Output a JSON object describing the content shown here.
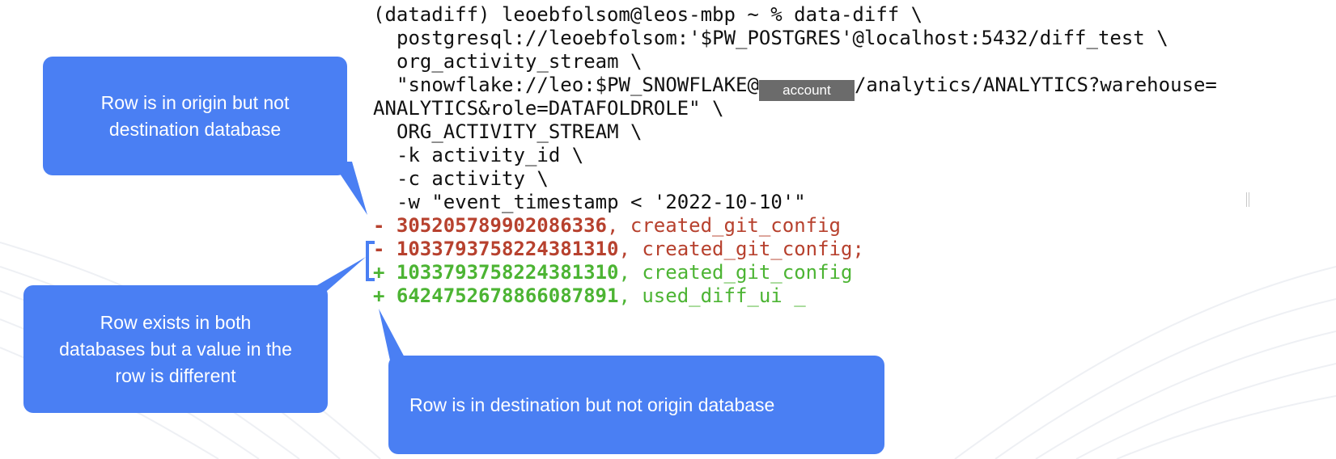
{
  "terminal": {
    "lines": {
      "l1": "(datadiff) leoebfolsom@leos-mbp ~ % data-diff \\",
      "l2": "postgresql://leoebfolsom:'$PW_POSTGRES'@localhost:5432/diff_test \\",
      "l3": "org_activity_stream \\",
      "l4_before": "\"snowflake://leo:$PW_SNOWFLAKE@",
      "l4_mask": "account",
      "l4_after": "/analytics/ANALYTICS?warehouse=",
      "l5": "ANALYTICS&role=DATAFOLDROLE\" \\",
      "l6": "ORG_ACTIVITY_STREAM \\",
      "l7": "-k activity_id \\",
      "l8": "-c activity \\",
      "l9": "-w \"event_timestamp < '2022-10-10'\""
    },
    "diff_rows": [
      {
        "sign": "-",
        "id": "305205789902086336",
        "sep": ", ",
        "value": "created_git_config"
      },
      {
        "sign": "-",
        "id": "1033793758224381310",
        "sep": ", ",
        "value": "created_git_config;"
      },
      {
        "sign": "+",
        "id": "1033793758224381310",
        "sep": ", ",
        "value": "created_git_config"
      },
      {
        "sign": "+",
        "id": "6424752678866087891",
        "sep": ", ",
        "value": "used_diff_ui _"
      }
    ]
  },
  "callouts": {
    "origin_only": "Row is in origin but not destination database",
    "different_value": "Row exists in both databases but a value in the row is different",
    "destination_only": "Row is in destination but not origin database"
  },
  "colors": {
    "removed": "#b7412e",
    "added": "#4cb433",
    "callout": "#4a7ff3",
    "mask": "#6b6b6b"
  }
}
